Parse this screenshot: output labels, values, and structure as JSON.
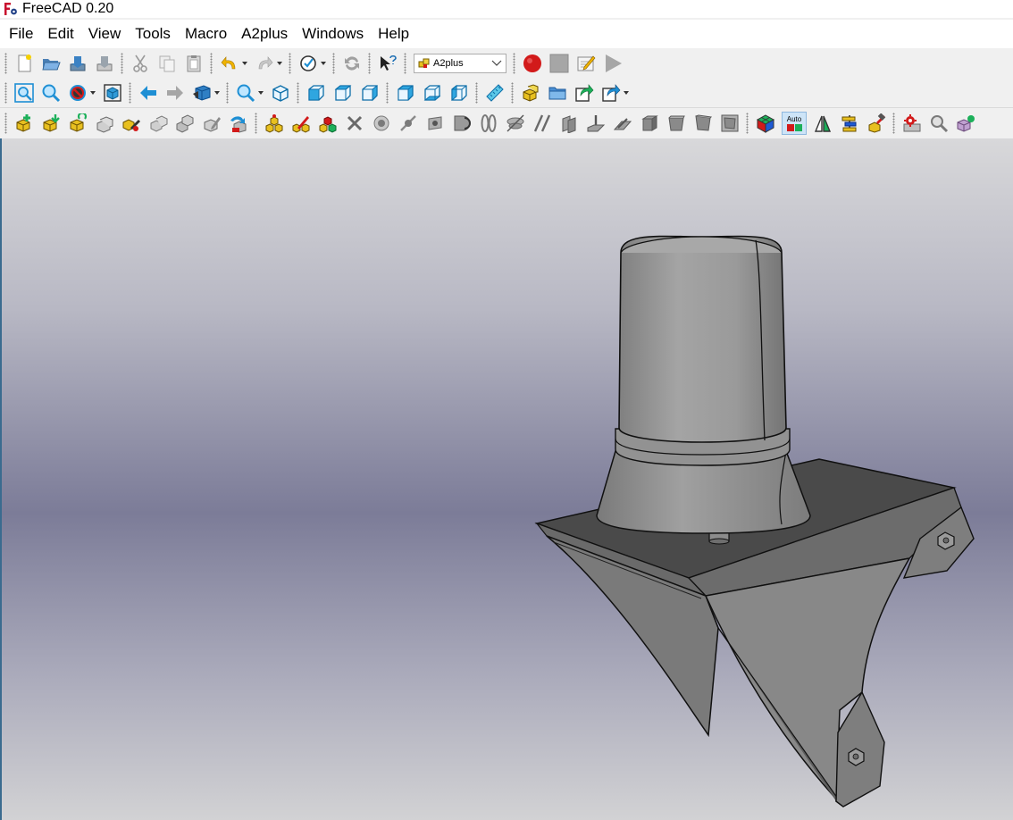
{
  "window": {
    "title": "FreeCAD 0.20"
  },
  "menu": [
    "File",
    "Edit",
    "View",
    "Tools",
    "Macro",
    "A2plus",
    "Windows",
    "Help"
  ],
  "toolbar_file": {
    "icons": [
      "new-file-icon",
      "open-folder-icon",
      "save-icon",
      "save-as-icon",
      "cut-icon",
      "copy-icon",
      "paste-icon",
      "undo-icon",
      "redo-icon",
      "refresh-icon",
      "whats-this-icon",
      "record-macro-icon",
      "stop-macro-icon",
      "edit-macro-icon",
      "run-macro-icon"
    ]
  },
  "workbench_selector": {
    "value": "A2plus"
  },
  "auto_toggle": {
    "label": "Auto"
  },
  "colors": {
    "accent_blue": "#1e8fd4",
    "record_red": "#d21a1a",
    "part_yellow": "#e8c020",
    "viewport_mid": "#7c7c98",
    "model_gray": "#8c8c8c"
  }
}
